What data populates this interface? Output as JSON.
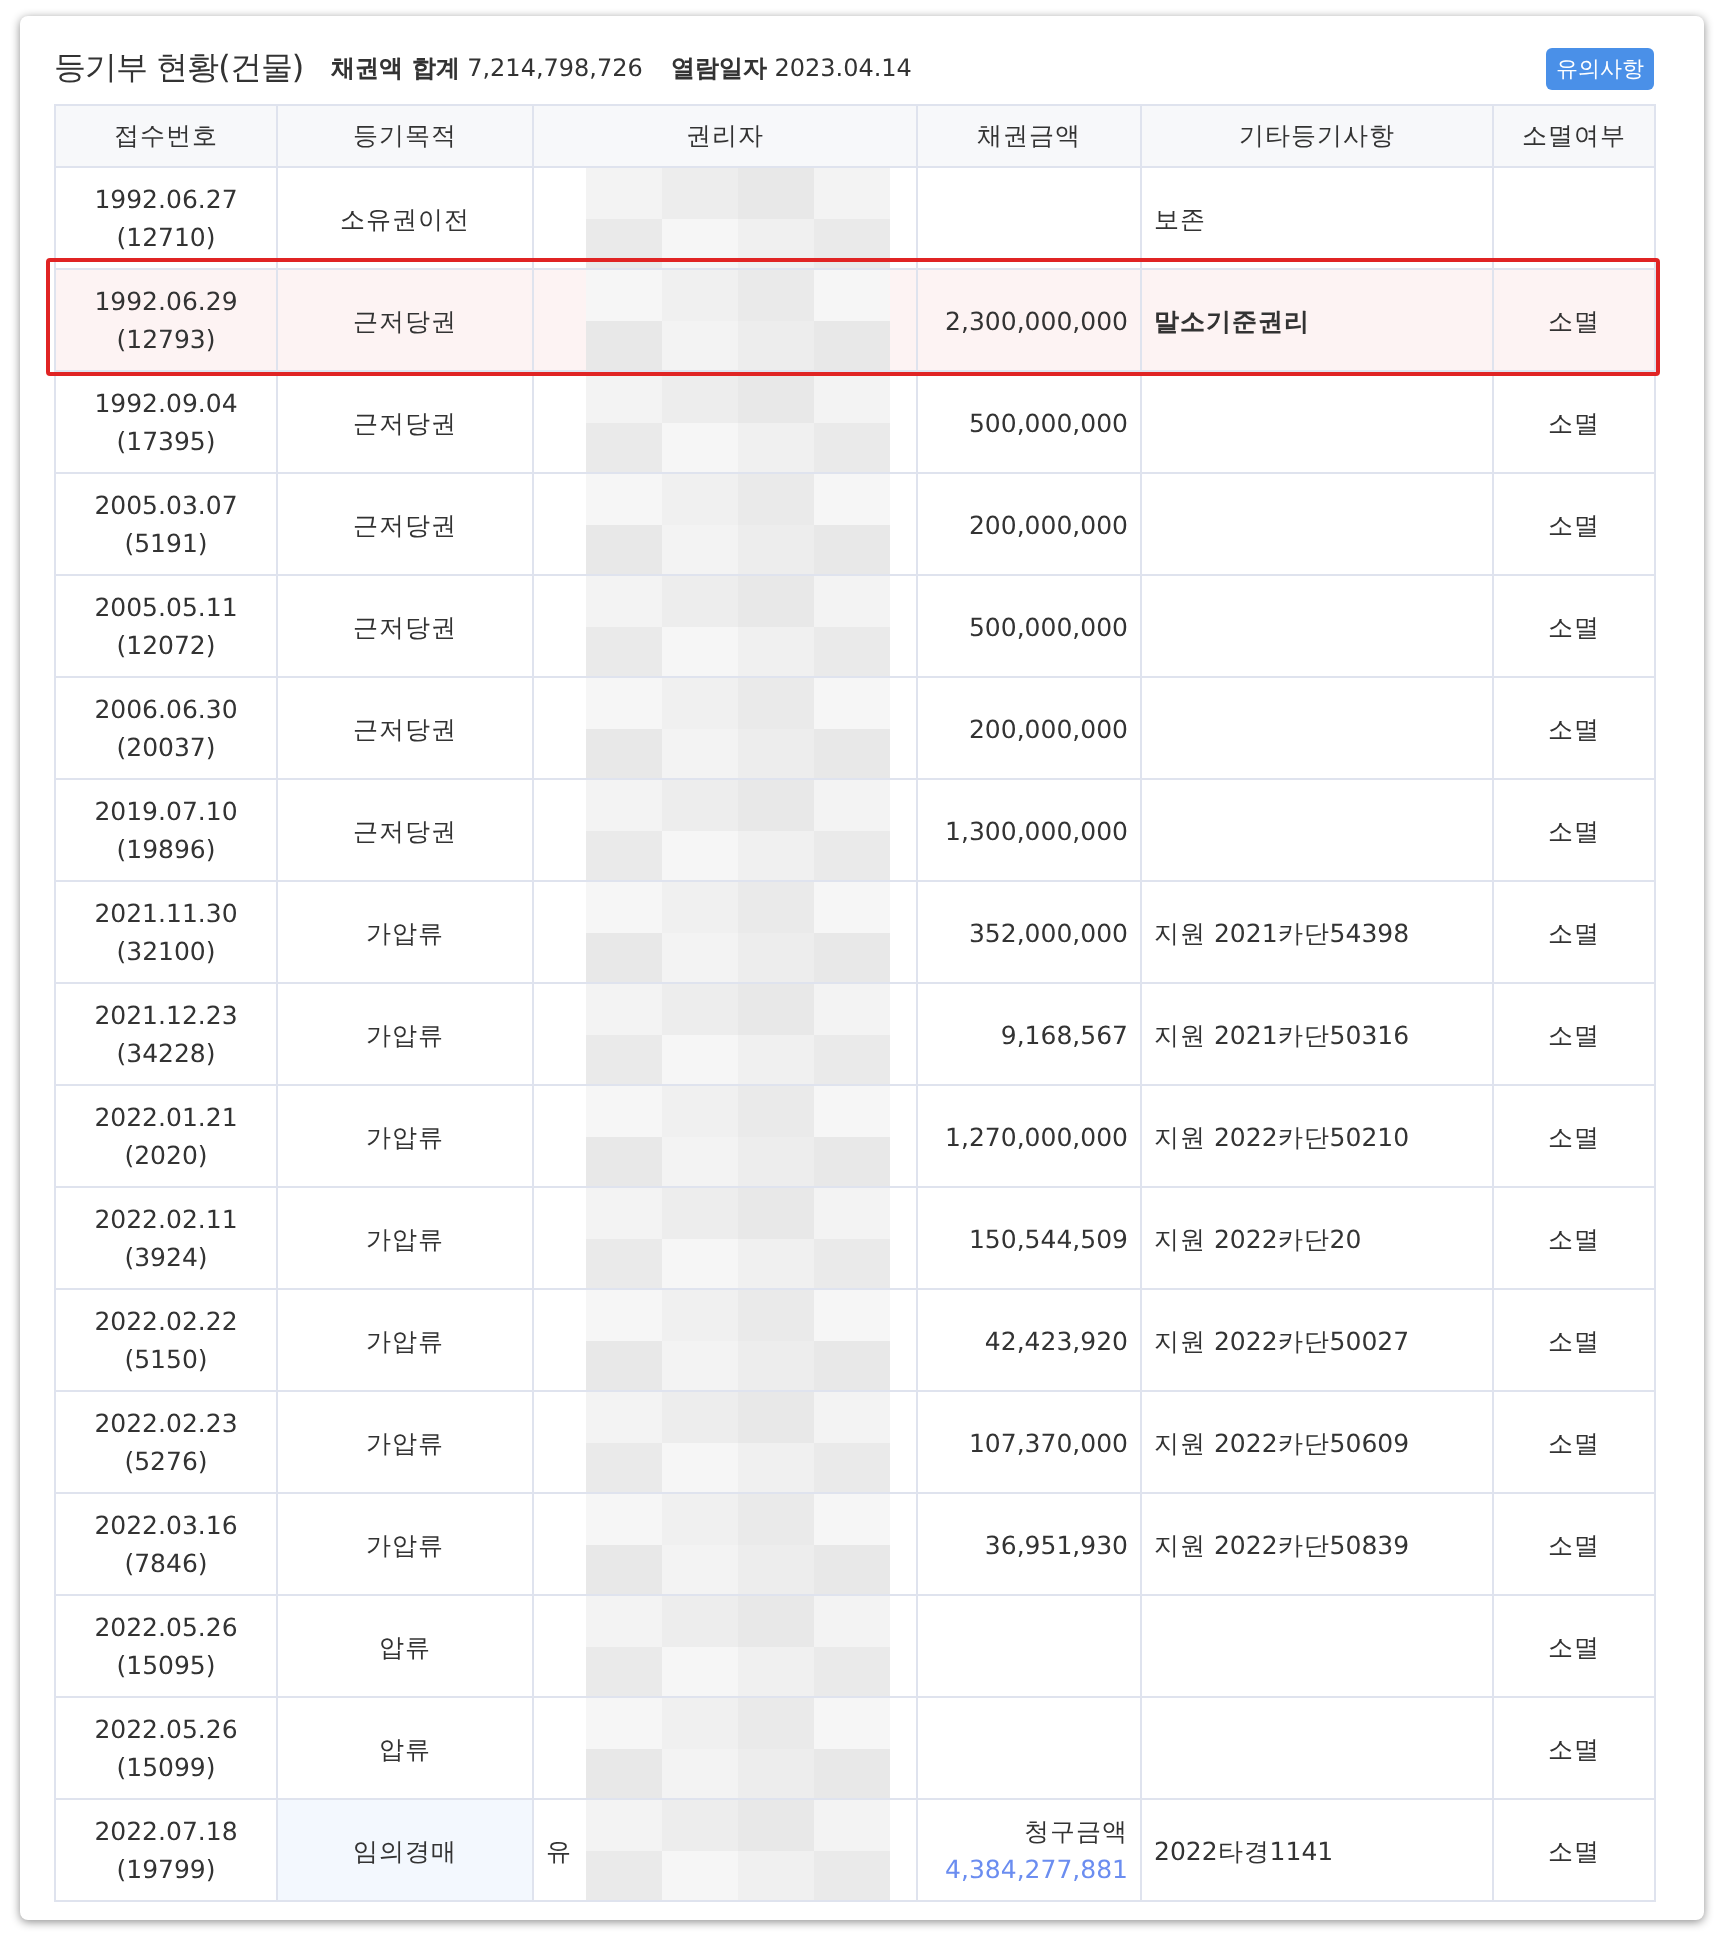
{
  "title": "등기부 현황(건물)",
  "summary": [
    {
      "label": "채권액 합계",
      "value": "7,214,798,726"
    },
    {
      "label": "열람일자",
      "value": "2023.04.14"
    }
  ],
  "notice_button": "유의사항",
  "columns": [
    "접수번호",
    "등기목적",
    "권리자",
    "채권금액",
    "기타등기사항",
    "소멸여부"
  ],
  "rows": [
    {
      "date": "1992.06.27",
      "number": "(12710)",
      "purpose": "소유권이전",
      "amount": "",
      "other": "보존",
      "extinct": "",
      "highlighted": false,
      "purpose_marked": false
    },
    {
      "date": "1992.06.29",
      "number": "(12793)",
      "purpose": "근저당권",
      "amount": "2,300,000,000",
      "other": "말소기준권리",
      "extinct": "소멸",
      "highlighted": true,
      "purpose_marked": false
    },
    {
      "date": "1992.09.04",
      "number": "(17395)",
      "purpose": "근저당권",
      "amount": "500,000,000",
      "other": "",
      "extinct": "소멸",
      "highlighted": false,
      "purpose_marked": false
    },
    {
      "date": "2005.03.07",
      "number": "(5191)",
      "purpose": "근저당권",
      "amount": "200,000,000",
      "other": "",
      "extinct": "소멸",
      "highlighted": false,
      "purpose_marked": false
    },
    {
      "date": "2005.05.11",
      "number": "(12072)",
      "purpose": "근저당권",
      "amount": "500,000,000",
      "other": "",
      "extinct": "소멸",
      "highlighted": false,
      "purpose_marked": false
    },
    {
      "date": "2006.06.30",
      "number": "(20037)",
      "purpose": "근저당권",
      "amount": "200,000,000",
      "other": "",
      "extinct": "소멸",
      "highlighted": false,
      "purpose_marked": false
    },
    {
      "date": "2019.07.10",
      "number": "(19896)",
      "purpose": "근저당권",
      "amount": "1,300,000,000",
      "other": "",
      "extinct": "소멸",
      "highlighted": false,
      "purpose_marked": false
    },
    {
      "date": "2021.11.30",
      "number": "(32100)",
      "purpose": "가압류",
      "amount": "352,000,000",
      "other": "지원 2021카단54398",
      "extinct": "소멸",
      "highlighted": false,
      "purpose_marked": false
    },
    {
      "date": "2021.12.23",
      "number": "(34228)",
      "purpose": "가압류",
      "amount": "9,168,567",
      "other": "지원 2021카단50316",
      "extinct": "소멸",
      "highlighted": false,
      "purpose_marked": false
    },
    {
      "date": "2022.01.21",
      "number": "(2020)",
      "purpose": "가압류",
      "amount": "1,270,000,000",
      "other": "지원 2022카단50210",
      "extinct": "소멸",
      "highlighted": false,
      "purpose_marked": false
    },
    {
      "date": "2022.02.11",
      "number": "(3924)",
      "purpose": "가압류",
      "amount": "150,544,509",
      "other": "지원 2022카단20",
      "extinct": "소멸",
      "highlighted": false,
      "purpose_marked": false
    },
    {
      "date": "2022.02.22",
      "number": "(5150)",
      "purpose": "가압류",
      "amount": "42,423,920",
      "other": "지원 2022카단50027",
      "extinct": "소멸",
      "highlighted": false,
      "purpose_marked": false
    },
    {
      "date": "2022.02.23",
      "number": "(5276)",
      "purpose": "가압류",
      "amount": "107,370,000",
      "other": "지원 2022카단50609",
      "extinct": "소멸",
      "highlighted": false,
      "purpose_marked": false
    },
    {
      "date": "2022.03.16",
      "number": "(7846)",
      "purpose": "가압류",
      "amount": "36,951,930",
      "other": "지원 2022카단50839",
      "extinct": "소멸",
      "highlighted": false,
      "purpose_marked": false
    },
    {
      "date": "2022.05.26",
      "number": "(15095)",
      "purpose": "압류",
      "amount": "",
      "other": "",
      "extinct": "소멸",
      "highlighted": false,
      "purpose_marked": false
    },
    {
      "date": "2022.05.26",
      "number": "(15099)",
      "purpose": "압류",
      "amount": "",
      "other": "",
      "extinct": "소멸",
      "highlighted": false,
      "purpose_marked": false
    },
    {
      "date": "2022.07.18",
      "number": "(19799)",
      "purpose": "임의경매",
      "holder": "유",
      "amount_label": "청구금액",
      "amount": "4,384,277,881",
      "other": "2022타경1141",
      "extinct": "소멸",
      "highlighted": false,
      "purpose_marked": true
    }
  ]
}
